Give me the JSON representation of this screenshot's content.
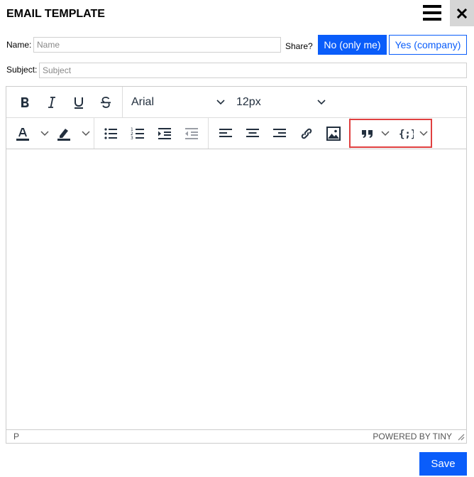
{
  "title": "EMAIL TEMPLATE",
  "name_field": {
    "label": "Name:",
    "placeholder": "Name",
    "value": ""
  },
  "share": {
    "label": "Share?",
    "no_label": "No (only me)",
    "yes_label": "Yes (company)"
  },
  "subject_field": {
    "label": "Subject:",
    "placeholder": "Subject",
    "value": ""
  },
  "editor": {
    "font_family": "Arial",
    "font_size": "12px",
    "status_path": "P",
    "powered_by": "POWERED BY TINY"
  },
  "save_label": "Save",
  "colors": {
    "accent": "#0a5dfa",
    "toolbar_icon": "#222f3e",
    "highlight": "#e04040"
  }
}
